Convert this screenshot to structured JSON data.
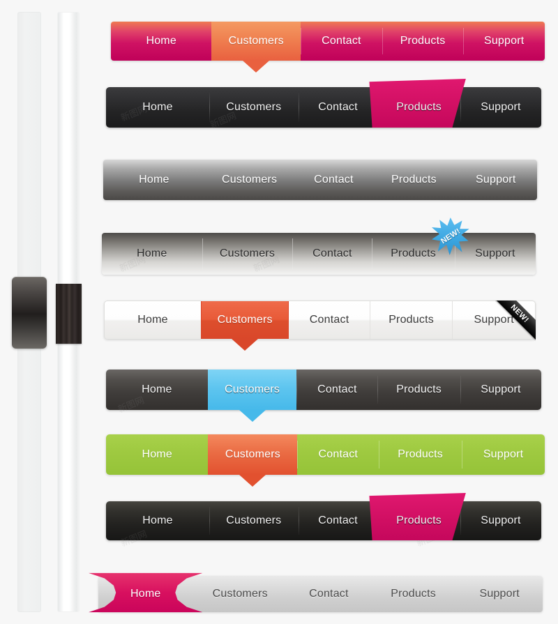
{
  "page": {
    "title": "Navigation Bar UI Kit",
    "background_color": "#f7f7f7"
  },
  "sliders": {
    "label": "vertical-sliders",
    "items": [
      {
        "name": "slider-flat",
        "track_color": "#f1f2f2",
        "thumb_color": "#211e1d",
        "value_position": "mid"
      },
      {
        "name": "slider-glossy",
        "track_color": "#ffffff",
        "thumb_color": "#272220",
        "value_position": "mid"
      }
    ]
  },
  "nav_labels": [
    "Home",
    "Customers",
    "Contact",
    "Products",
    "Support"
  ],
  "navbars": [
    {
      "id": "bar1",
      "name": "navbar-pink-magenta",
      "style": "pink-gradient",
      "accent": "#cf1263",
      "active_accent": "#e9603f",
      "active_index": 1,
      "badge": null,
      "items": [
        "Home",
        "Customers",
        "Contact",
        "Products",
        "Support"
      ]
    },
    {
      "id": "bar2",
      "name": "navbar-dark-pink-ribbon",
      "style": "dark-charcoal",
      "accent": "#2e2e30",
      "active_accent": "#d10f63",
      "active_index": 3,
      "badge": null,
      "items": [
        "Home",
        "Customers",
        "Contact",
        "Products",
        "Support"
      ]
    },
    {
      "id": "bar3",
      "name": "navbar-gray-light-to-dark",
      "style": "gray-gradient-down",
      "accent": "#7c7c7c",
      "active_accent": null,
      "active_index": -1,
      "badge": null,
      "items": [
        "Home",
        "Customers",
        "Contact",
        "Products",
        "Support"
      ]
    },
    {
      "id": "bar4",
      "name": "navbar-gray-dark-to-light",
      "style": "gray-gradient-up",
      "accent": "#a6a4a0",
      "active_accent": null,
      "active_index": -1,
      "badge": {
        "type": "starburst",
        "text": "NEW!",
        "color": "#3aa5e0",
        "on_index": 3
      },
      "items": [
        "Home",
        "Customers",
        "Contact",
        "Products",
        "Support"
      ]
    },
    {
      "id": "bar5",
      "name": "navbar-white-orange",
      "style": "white-tabs",
      "accent": "#ffffff",
      "active_accent": "#dd4f2d",
      "active_index": 1,
      "badge": {
        "type": "corner-ribbon",
        "text": "NEW!",
        "color": "#000000",
        "on_index": 4
      },
      "items": [
        "Home",
        "Customers",
        "Contact",
        "Products",
        "Support"
      ]
    },
    {
      "id": "bar6",
      "name": "navbar-graphite-blue",
      "style": "graphite",
      "accent": "#403d3b",
      "active_accent": "#46b9ea",
      "active_index": 1,
      "badge": null,
      "items": [
        "Home",
        "Customers",
        "Contact",
        "Products",
        "Support"
      ]
    },
    {
      "id": "bar7",
      "name": "navbar-green-orange",
      "style": "green",
      "accent": "#9fca41",
      "active_accent": "#e2512f",
      "active_index": 1,
      "badge": null,
      "items": [
        "Home",
        "Customers",
        "Contact",
        "Products",
        "Support"
      ]
    },
    {
      "id": "bar8",
      "name": "navbar-black-pink-ribbon",
      "style": "near-black",
      "accent": "#232220",
      "active_accent": "#d10f63",
      "active_index": 3,
      "badge": null,
      "items": [
        "Home",
        "Customers",
        "Contact",
        "Products",
        "Support"
      ]
    },
    {
      "id": "bar9",
      "name": "navbar-silver-pink-star",
      "style": "silver",
      "accent": "#dcdcdc",
      "active_accent": "#d8105f",
      "active_index": 0,
      "badge": null,
      "items": [
        "Home",
        "Customers",
        "Contact",
        "Products",
        "Support"
      ]
    }
  ],
  "watermarks": [
    "新图网",
    "新图网",
    "新图网",
    "新图网",
    "新图网",
    "新图网",
    "新图网",
    "新图网"
  ]
}
